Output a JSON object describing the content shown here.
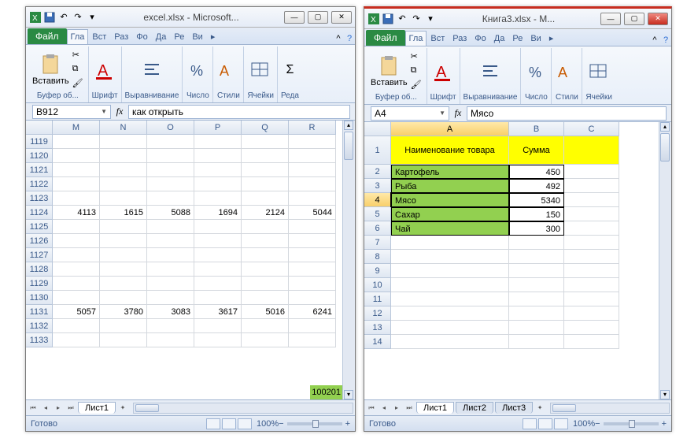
{
  "win1": {
    "title": "excel.xlsx - Microsoft...",
    "file_tab": "Файл",
    "tabs": [
      "Гла",
      "Вст",
      "Раз",
      "Фо",
      "Да",
      "Ре",
      "Ви"
    ],
    "groups": {
      "clipboard": {
        "paste": "Вставить",
        "label": "Буфер об..."
      },
      "font": {
        "label": "Шрифт"
      },
      "align": {
        "label": "Выравнивание"
      },
      "number": {
        "label": "Число"
      },
      "styles": {
        "label": "Стили"
      },
      "cells": {
        "label": "Ячейки"
      },
      "edit": {
        "label": "Реда"
      }
    },
    "namebox": "B912",
    "formula": "как открыть",
    "columns": [
      "M",
      "N",
      "O",
      "P",
      "Q",
      "R"
    ],
    "rows": [
      "1119",
      "1120",
      "1121",
      "1122",
      "1123",
      "1124",
      "1125",
      "1126",
      "1127",
      "1128",
      "1129",
      "1130",
      "1131",
      "1132",
      "1133"
    ],
    "data": {
      "1124": [
        "4113",
        "1615",
        "5088",
        "1694",
        "2124",
        "5044"
      ],
      "1131": [
        "5057",
        "3780",
        "3083",
        "3617",
        "5016",
        "6241"
      ]
    },
    "green_fragment": "100201",
    "sheet": "Лист1",
    "status": "Готово",
    "zoom": "100%"
  },
  "win2": {
    "title": "Книга3.xlsx - M...",
    "file_tab": "Файл",
    "tabs": [
      "Гла",
      "Вст",
      "Раз",
      "Фо",
      "Да",
      "Ре",
      "Ви"
    ],
    "groups": {
      "clipboard": {
        "paste": "Вставить",
        "label": "Буфер об..."
      },
      "font": {
        "label": "Шрифт"
      },
      "align": {
        "label": "Выравнивание"
      },
      "number": {
        "label": "Число"
      },
      "styles": {
        "label": "Стили"
      },
      "cells": {
        "label": "Ячейки"
      }
    },
    "namebox": "A4",
    "formula": "Мясо",
    "columns": [
      "A",
      "B",
      "C"
    ],
    "rows": [
      "1",
      "2",
      "3",
      "4",
      "5",
      "6",
      "7"
    ],
    "header_row": {
      "a": "Наименование товара",
      "b": "Сумма"
    },
    "items": [
      {
        "name": "Картофель",
        "sum": "450"
      },
      {
        "name": "Рыба",
        "sum": "492"
      },
      {
        "name": "Мясо",
        "sum": "5340"
      },
      {
        "name": "Сахар",
        "sum": "150"
      },
      {
        "name": "Чай",
        "sum": "300"
      }
    ],
    "selected_cell": "A4",
    "sheets": [
      "Лист1",
      "Лист2",
      "Лист3"
    ],
    "status": "Готово",
    "zoom": "100%"
  },
  "colors": {
    "file_tab": "#2a8a43",
    "yellow": "#ffff00",
    "green": "#92d050"
  }
}
